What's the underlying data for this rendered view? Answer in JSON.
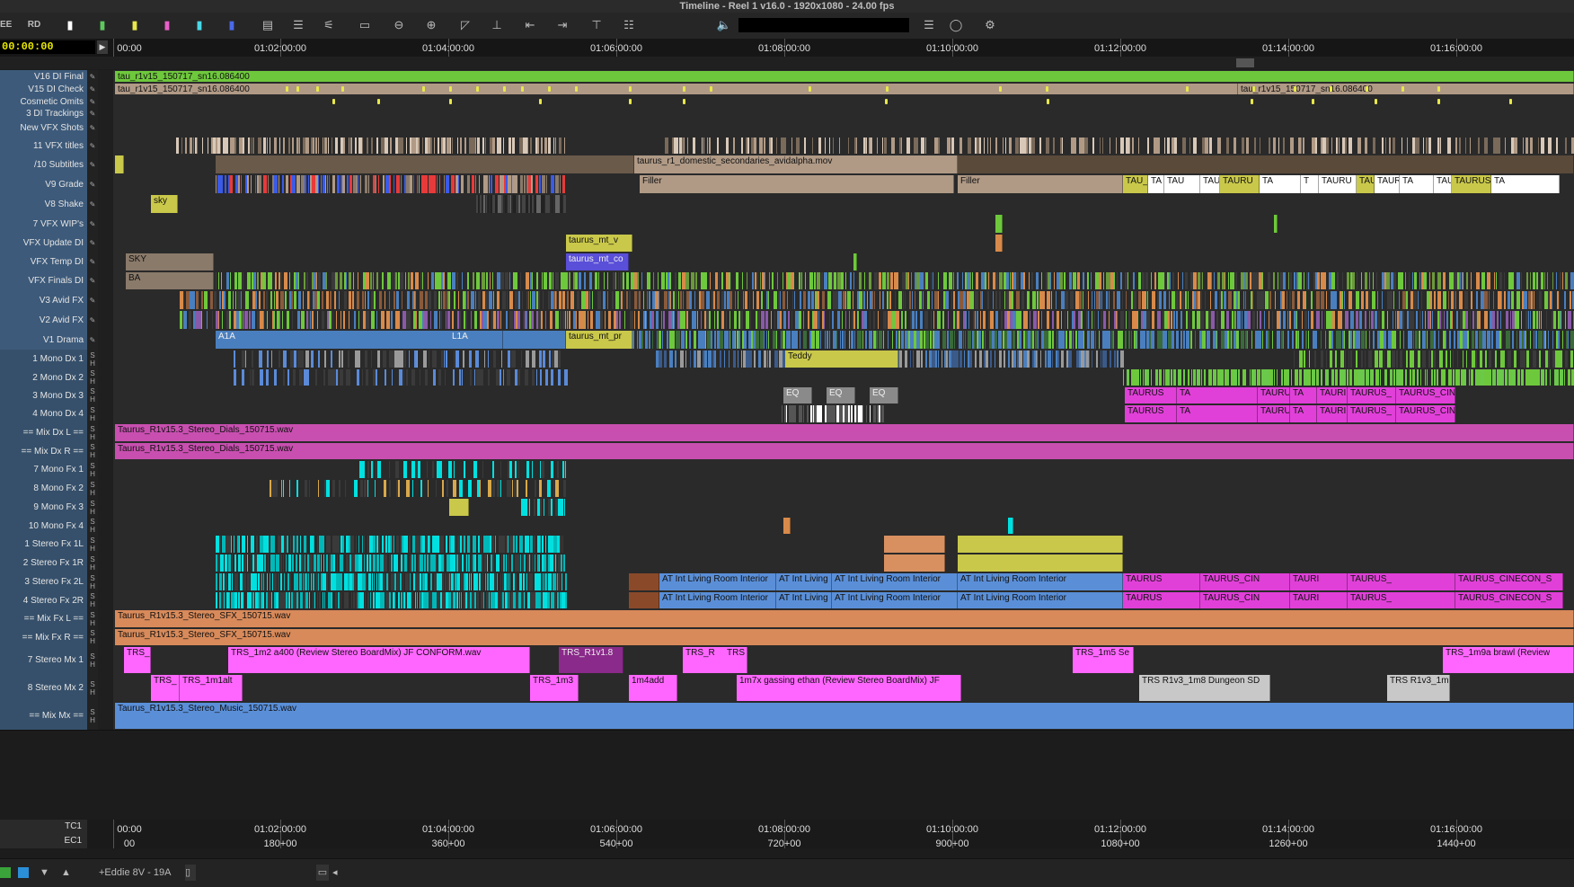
{
  "window": {
    "title": "Timeline - Reel 1 v16.0 - 1920x1080 - 24.00 fps"
  },
  "toolbar": {
    "left_labels": [
      "EE",
      "RD"
    ],
    "icons": [
      "track-marker-white-icon",
      "track-marker-green-icon",
      "track-marker-yellow-icon",
      "track-marker-pink-icon",
      "track-marker-cyan-icon",
      "track-marker-blue-icon",
      "segment-mode-icon",
      "lift-icon",
      "overwrite-icon",
      "splice-icon",
      "zoom-out-icon",
      "zoom-in-icon",
      "trim-icon",
      "slip-icon",
      "extract-icon",
      "overwrite-arrow-icon",
      "top-icon",
      "menu-icon",
      "speaker-icon",
      "fast-menu-icon",
      "record-icon",
      "settings-gear-icon"
    ]
  },
  "timecode": {
    "current": "00:00:00"
  },
  "ruler": {
    "labels": [
      "00:00",
      "01:02:00:00",
      "01:04:00:00",
      "01:06:00:00",
      "01:08:00:00",
      "01:10:00:00",
      "01:12:00:00",
      "01:14:00:00",
      "01:16:00:00"
    ],
    "bottom_tc1": [
      "00:00",
      "01:02:00:00",
      "01:04:00:00",
      "01:06:00:00",
      "01:08:00:00",
      "01:10:00:00",
      "01:12:00:00",
      "01:14:00:00",
      "01:16:00:00"
    ],
    "bottom_ec1": [
      "00",
      "180+00",
      "360+00",
      "540+00",
      "720+00",
      "900+00",
      "1080+00",
      "1260+00",
      "1440+00"
    ],
    "row_labels": [
      "TC1",
      "EC1"
    ]
  },
  "tracks": [
    {
      "id": "V16",
      "name": "V16 DI Final",
      "kind": "video"
    },
    {
      "id": "V15",
      "name": "V15 DI Check",
      "kind": "video"
    },
    {
      "id": "V14",
      "name": "Cosmetic Omits",
      "kind": "video"
    },
    {
      "id": "V13",
      "name": "3  DI Trackings",
      "kind": "video"
    },
    {
      "id": "V12",
      "name": "New VFX Shots",
      "kind": "video"
    },
    {
      "id": "V11",
      "name": "11 VFX titles",
      "kind": "video"
    },
    {
      "id": "V10",
      "name": "/10  Subtitles",
      "kind": "video"
    },
    {
      "id": "V9",
      "name": "V9  Grade",
      "kind": "video"
    },
    {
      "id": "V8",
      "name": "V8  Shake",
      "kind": "video"
    },
    {
      "id": "V7",
      "name": "7  VFX WIP's",
      "kind": "video"
    },
    {
      "id": "V6",
      "name": "VFX Update DI",
      "kind": "video"
    },
    {
      "id": "V5",
      "name": "VFX Temp DI",
      "kind": "video"
    },
    {
      "id": "V4",
      "name": "VFX Finals DI",
      "kind": "video"
    },
    {
      "id": "V3",
      "name": "V3  Avid FX",
      "kind": "video"
    },
    {
      "id": "V2",
      "name": "V2  Avid FX",
      "kind": "video"
    },
    {
      "id": "V1",
      "name": "V1  Drama",
      "kind": "video"
    },
    {
      "id": "A1",
      "name": "1  Mono Dx 1",
      "kind": "audio"
    },
    {
      "id": "A2",
      "name": "2  Mono Dx 2",
      "kind": "audio"
    },
    {
      "id": "A3",
      "name": "3  Mono Dx 3",
      "kind": "audio"
    },
    {
      "id": "A4",
      "name": "4  Mono Dx 4",
      "kind": "audio"
    },
    {
      "id": "A5",
      "name": "== Mix Dx L ==",
      "kind": "audio"
    },
    {
      "id": "A6",
      "name": "== Mix Dx R ==",
      "kind": "audio"
    },
    {
      "id": "A7",
      "name": "7  Mono Fx 1",
      "kind": "audio"
    },
    {
      "id": "A8",
      "name": "8  Mono Fx 2",
      "kind": "audio"
    },
    {
      "id": "A9",
      "name": "9  Mono Fx 3",
      "kind": "audio"
    },
    {
      "id": "A10",
      "name": "10  Mono Fx 4",
      "kind": "audio"
    },
    {
      "id": "A11",
      "name": "1  Stereo Fx 1L",
      "kind": "audio"
    },
    {
      "id": "A12",
      "name": "2  Stereo Fx 1R",
      "kind": "audio"
    },
    {
      "id": "A13",
      "name": "3  Stereo Fx 2L",
      "kind": "audio"
    },
    {
      "id": "A14",
      "name": "4  Stereo Fx 2R",
      "kind": "audio"
    },
    {
      "id": "A15",
      "name": "== Mix Fx L ==",
      "kind": "audio"
    },
    {
      "id": "A16",
      "name": "== Mix Fx R ==",
      "kind": "audio"
    },
    {
      "id": "A17",
      "name": "7  Stereo Mx 1",
      "kind": "audio"
    },
    {
      "id": "A18",
      "name": "8  Stereo Mx 2",
      "kind": "audio"
    },
    {
      "id": "A19",
      "name": "== Mix Mx ==",
      "kind": "audio"
    }
  ],
  "clips": {
    "v16_a": "tau_r1v15_150717_sn16.086400",
    "v15_a": "tau_r1v15_150717_sn16.086400",
    "v15_b": "tau_r1v15_150717_sn16.086400",
    "v10_a": "taurus_r1_domestic_secondaries_avidalpha.mov",
    "v9_filler1": "Filler",
    "v9_filler2": "Filler",
    "v9_tau": [
      "TAU_",
      "TA",
      "TAU",
      "TAU",
      "TAURU",
      "TA",
      "T",
      "TAURU",
      "TAU",
      "TAURU",
      "TA",
      "TAURUS",
      "TAURUS_Cin",
      "TA"
    ],
    "v8_sky": "sky",
    "v6_taurus": "taurus_mt_v",
    "v5_taurus": "taurus_mt_co",
    "v5_sky": [
      "SKY",
      "BA"
    ],
    "v1_a1a": "A1A",
    "v1_l1a": "L1A",
    "v1_taurus": "taurus_mt_pr",
    "a1_teddy": "Teddy",
    "a3_eq": [
      "EQ",
      "EQ",
      "EQ"
    ],
    "a3_taurus": [
      "TAURUS",
      "TA",
      "TAURUS_CIN",
      "TA",
      "TAURI",
      "TAURUS_",
      "TAURUS_CINECON_S"
    ],
    "a4_taurus": [
      "TAURUS",
      "TA",
      "TAURUS_CIN",
      "TA",
      "TAURI",
      "TAURUS_",
      "TAURUS_CINECON_S"
    ],
    "mix_dx_l": "Taurus_R1v15.3_Stereo_Dials_150715.wav",
    "mix_dx_r": "Taurus_R1v15.3_Stereo_Dials_150715.wav",
    "fx_living": [
      "AT Int Living Room Interior",
      "AT Int Living",
      "AT Int Living Room Interior",
      "AT Int Living Room Interior"
    ],
    "fx_taurus": [
      "TAURUS",
      "TAURUS_CIN",
      "TAURI",
      "TAURUS_",
      "TAURUS_CINECON_S"
    ],
    "mix_fx_l": "Taurus_R1v15.3_Stereo_SFX_150715.wav",
    "mix_fx_r": "Taurus_R1v15.3_Stereo_SFX_150715.wav",
    "mx1": [
      "TRS_",
      "TRS_1m2 a400 (Review Stereo BoardMix) JF CONFORM.wav",
      "TRS_R1v1.8",
      "TRS_R",
      "TRS",
      "TRS_1m5 Se",
      "TRS_1m9a brawl (Review"
    ],
    "mx2": [
      "TRS_",
      "TRS_1m1alt",
      "TRS_1m3",
      "1m4add",
      "1m7x gassing ethan (Review Stereo BoardMix) JF",
      "TRS R1v3_1m8 Dungeon SD",
      "TRS R1v3_1m"
    ],
    "mix_mx": "Taurus_R1v15.3_Stereo_Music_150715.wav"
  },
  "status": {
    "source_label": "+Eddie 8V - 19A",
    "icons": [
      "green-square-icon",
      "monitor-icon",
      "down-arrow-icon",
      "up-arrow-icon",
      "scroll-left-icon"
    ]
  },
  "colors": {
    "green": "#6ec83c",
    "tan": "#b09a86",
    "purple": "#5a4fd8",
    "blue": "#4a7fbf",
    "yellow": "#c9c84a",
    "cyan": "#00e0e0",
    "orange": "#d88a4a",
    "magenta": "#e040d8",
    "pink": "#ff66ff",
    "salmon": "#d89060",
    "mixmagenta": "#c84fb0",
    "mixorange": "#d88a5a",
    "mixblue": "#5a8fd8",
    "grey": "#c8c8c8"
  }
}
